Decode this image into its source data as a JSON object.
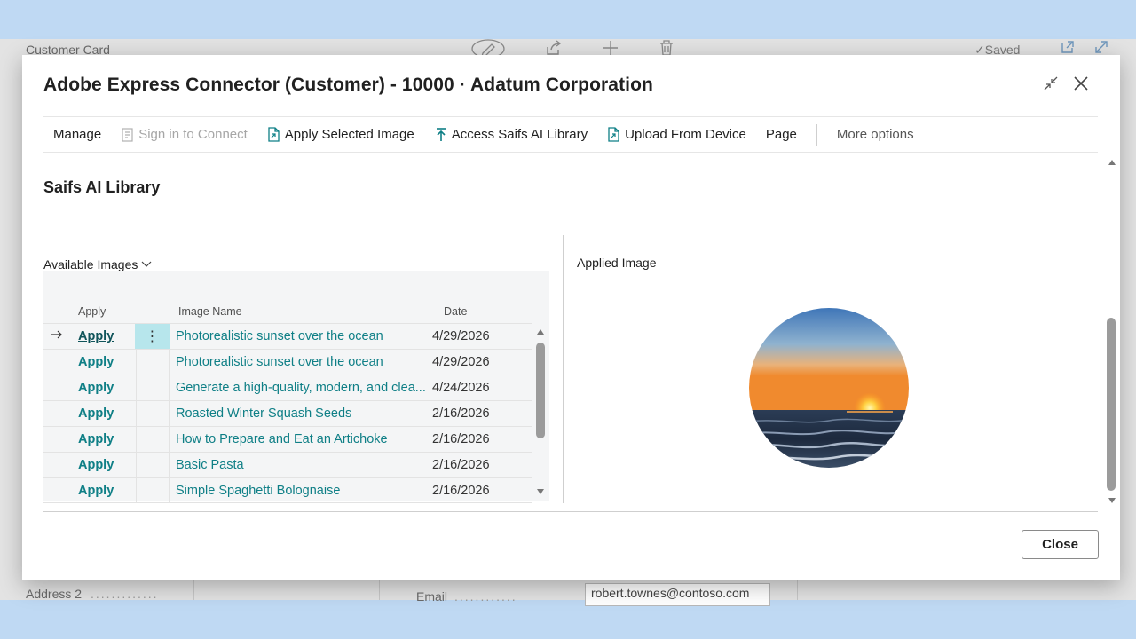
{
  "background": {
    "page_title": "Customer Card",
    "saved_label": "Saved",
    "address2_label": "Address 2",
    "email_label": "Email",
    "email_value": "robert.townes@contoso.com"
  },
  "modal": {
    "title": "Adobe Express Connector (Customer) - 10000 · Adatum Corporation",
    "actions": {
      "manage": "Manage",
      "sign_in": "Sign in to Connect",
      "apply_selected": "Apply Selected Image",
      "access_library": "Access Saifs AI Library",
      "upload": "Upload From Device",
      "page": "Page",
      "more": "More options"
    },
    "section_title": "Saifs AI Library",
    "available_label": "Available Images",
    "grid": {
      "headers": {
        "apply": "Apply",
        "image_name": "Image Name",
        "date": "Date"
      },
      "rows": [
        {
          "apply": "Apply",
          "name": "Photorealistic sunset over the ocean",
          "date": "4/29/2026"
        },
        {
          "apply": "Apply",
          "name": "Photorealistic sunset over the ocean",
          "date": "4/29/2026"
        },
        {
          "apply": "Apply",
          "name": "Generate a high-quality, modern, and clea...",
          "date": "4/24/2026"
        },
        {
          "apply": "Apply",
          "name": "Roasted Winter Squash Seeds",
          "date": "2/16/2026"
        },
        {
          "apply": "Apply",
          "name": "How to Prepare and Eat an Artichoke",
          "date": "2/16/2026"
        },
        {
          "apply": "Apply",
          "name": "Basic Pasta",
          "date": "2/16/2026"
        },
        {
          "apply": "Apply",
          "name": "Simple Spaghetti Bolognaise",
          "date": "2/16/2026"
        }
      ]
    },
    "applied_label": "Applied Image",
    "close_label": "Close",
    "colors": {
      "link": "#0f7f86",
      "selected_cell": "#b7e6ec"
    }
  }
}
